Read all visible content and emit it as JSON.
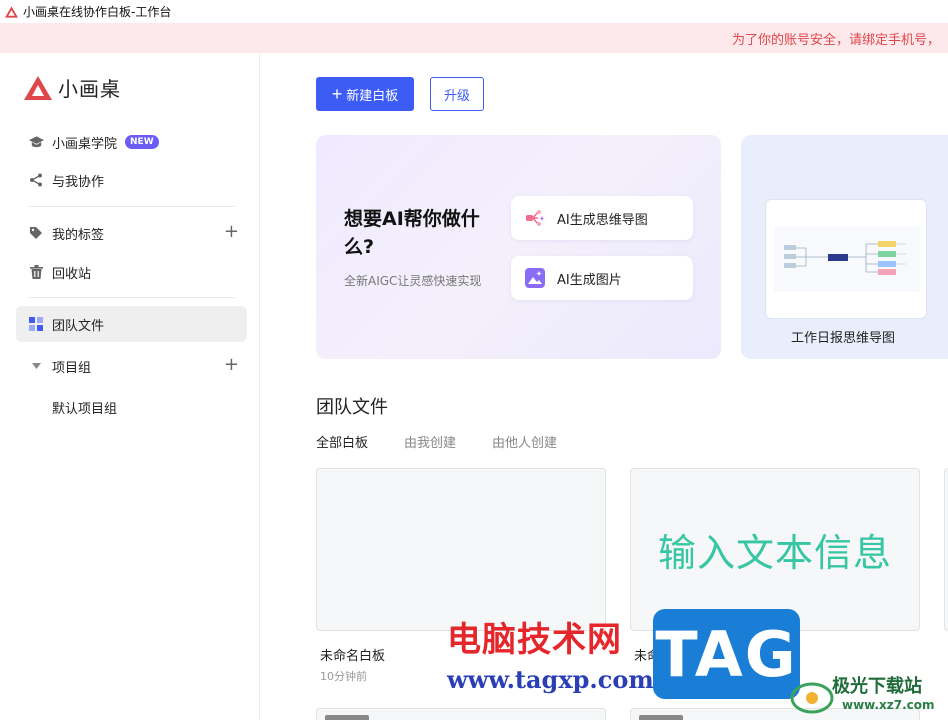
{
  "window": {
    "title": "小画桌在线协作白板-工作台"
  },
  "banner": {
    "text": "为了你的账号安全，请绑定手机号，"
  },
  "sidebar": {
    "logo_text": "小画桌",
    "items": [
      {
        "label": "小画桌学院",
        "badge": "NEW",
        "icon": "graduation-cap-icon"
      },
      {
        "label": "与我协作",
        "icon": "share-icon"
      },
      {
        "label": "我的标签",
        "icon": "tag-icon",
        "action": "+"
      },
      {
        "label": "回收站",
        "icon": "trash-icon"
      },
      {
        "label": "团队文件",
        "icon": "grid-icon",
        "active": true
      },
      {
        "label": "项目组",
        "icon": "caret-down-icon",
        "action": "+"
      }
    ],
    "sub_items": [
      {
        "label": "默认项目组"
      }
    ]
  },
  "toolbar": {
    "new_label": "新建白板",
    "upgrade_label": "升级"
  },
  "ai_card": {
    "title": "想要AI帮你做什么?",
    "subtitle": "全新AIGC让灵感快速实现",
    "options": [
      {
        "label": "AI生成思维导图",
        "icon": "mindmap-ai-icon"
      },
      {
        "label": "AI生成图片",
        "icon": "image-ai-icon"
      }
    ]
  },
  "template_card": {
    "label": "工作日报思维导图"
  },
  "section": {
    "title": "团队文件",
    "tabs": [
      {
        "label": "全部白板",
        "active": true
      },
      {
        "label": "由我创建"
      },
      {
        "label": "由他人创建"
      }
    ]
  },
  "files": [
    {
      "name": "未命名白板",
      "time": "10分钟前",
      "preview_text": ""
    },
    {
      "name": "未命名白板",
      "time": "",
      "preview_text": "输入文本信息"
    }
  ],
  "watermark": {
    "cn": "电脑技术网",
    "url": "www.tagxp.com",
    "tag": "TAG",
    "xz_name": "极光下载站",
    "xz_url": "www.xz7.com"
  },
  "colors": {
    "accent": "#3d5cf4",
    "banner_bg": "#fde9eb",
    "banner_text": "#e0474b",
    "badge": "#6c5cf6",
    "preview_text": "#36c6a3"
  }
}
